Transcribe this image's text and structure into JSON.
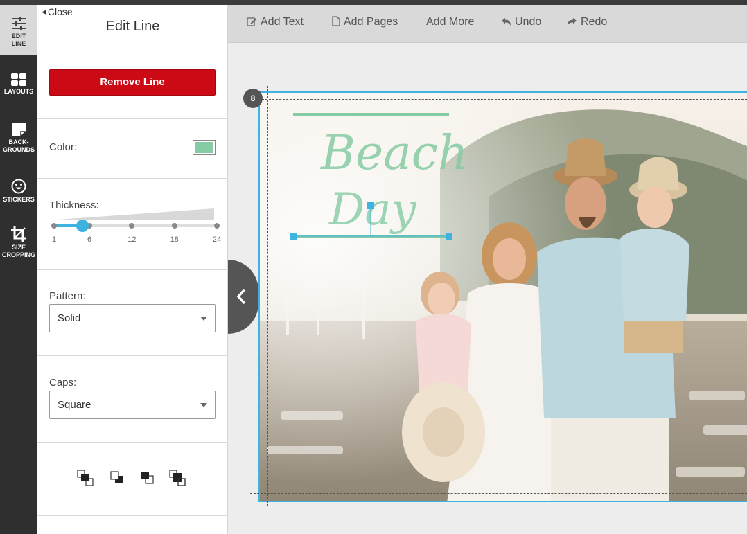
{
  "rail": {
    "items": [
      {
        "label": "EDIT\nLINE",
        "icon": "sliders-icon",
        "active": true
      },
      {
        "label": "LAYOUTS",
        "icon": "grid-icon"
      },
      {
        "label": "BACK-\nGROUNDS",
        "icon": "page-corner-icon"
      },
      {
        "label": "STICKERS",
        "icon": "smiley-icon"
      },
      {
        "label": "SIZE\nCROPPING",
        "icon": "crop-icon"
      }
    ]
  },
  "panel": {
    "close_label": "Close",
    "title": "Edit Line",
    "remove_label": "Remove Line",
    "color": {
      "label": "Color:",
      "value": "#86cba3"
    },
    "thickness": {
      "label": "Thickness:",
      "ticks": [
        "1",
        "6",
        "12",
        "18",
        "24"
      ],
      "value": 5
    },
    "pattern": {
      "label": "Pattern:",
      "value": "Solid"
    },
    "caps": {
      "label": "Caps:",
      "value": "Square"
    },
    "layer_buttons": [
      "bring-to-front-icon",
      "bring-forward-icon",
      "send-backward-icon",
      "send-to-back-icon"
    ]
  },
  "toolbar": {
    "add_text": "Add Text",
    "add_pages": "Add Pages",
    "add_more": "Add More",
    "undo": "Undo",
    "redo": "Redo"
  },
  "canvas": {
    "page_number": "8",
    "photo_text_line1": "Beach",
    "photo_text_line2": "Day",
    "accent_color": "#3fb3e0",
    "line_color": "#86cba3"
  }
}
